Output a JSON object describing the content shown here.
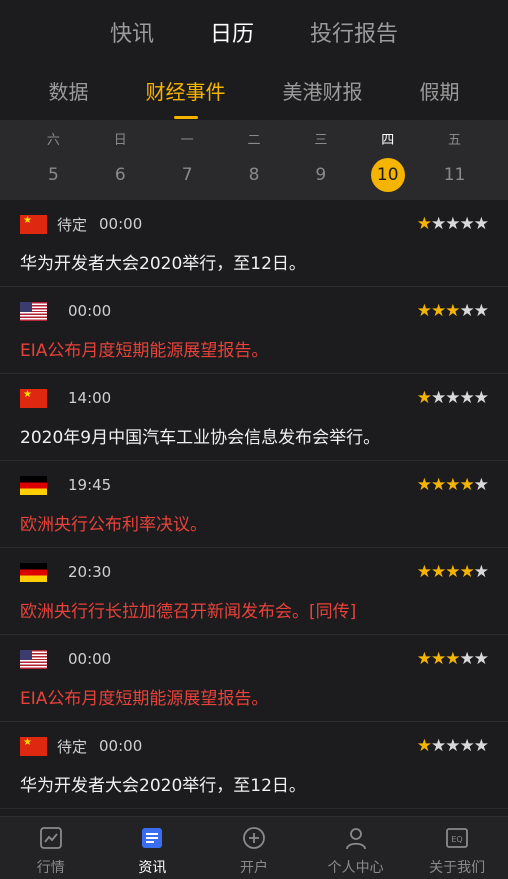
{
  "top_tabs": [
    {
      "label": "快讯",
      "active": false
    },
    {
      "label": "日历",
      "active": true
    },
    {
      "label": "投行报告",
      "active": false
    }
  ],
  "sub_tabs": [
    {
      "label": "数据",
      "active": false
    },
    {
      "label": "财经事件",
      "active": true
    },
    {
      "label": "美港财报",
      "active": false
    },
    {
      "label": "假期",
      "active": false
    }
  ],
  "week": [
    {
      "weekday": "六",
      "date": "5"
    },
    {
      "weekday": "日",
      "date": "6"
    },
    {
      "weekday": "一",
      "date": "7"
    },
    {
      "weekday": "二",
      "date": "8"
    },
    {
      "weekday": "三",
      "date": "9"
    },
    {
      "weekday": "四",
      "date": "10",
      "active": true
    },
    {
      "weekday": "五",
      "date": "11"
    }
  ],
  "events": [
    {
      "flag": "cn",
      "status": "待定",
      "time": "00:00",
      "stars": 1,
      "title": "华为开发者大会2020举行，至12日。",
      "highlight": false
    },
    {
      "flag": "us",
      "status": "",
      "time": "00:00",
      "stars": 3,
      "title": "EIA公布月度短期能源展望报告。",
      "highlight": true
    },
    {
      "flag": "cn",
      "status": "",
      "time": "14:00",
      "stars": 1,
      "title": "2020年9月中国汽车工业协会信息发布会举行。",
      "highlight": false
    },
    {
      "flag": "de",
      "status": "",
      "time": "19:45",
      "stars": 4,
      "title": "欧洲央行公布利率决议。",
      "highlight": true
    },
    {
      "flag": "de",
      "status": "",
      "time": "20:30",
      "stars": 4,
      "title": "欧洲央行行长拉加德召开新闻发布会。[同传]",
      "highlight": true
    },
    {
      "flag": "us",
      "status": "",
      "time": "00:00",
      "stars": 3,
      "title": "EIA公布月度短期能源展望报告。",
      "highlight": true
    },
    {
      "flag": "cn",
      "status": "待定",
      "time": "00:00",
      "stars": 1,
      "title": "华为开发者大会2020举行，至12日。",
      "highlight": false
    }
  ],
  "bottom_nav": [
    {
      "label": "行情",
      "icon": "chart-icon",
      "active": false
    },
    {
      "label": "资讯",
      "icon": "news-icon",
      "active": true
    },
    {
      "label": "开户",
      "icon": "plus-circle-icon",
      "active": false
    },
    {
      "label": "个人中心",
      "icon": "user-icon",
      "active": false
    },
    {
      "label": "关于我们",
      "icon": "about-icon",
      "active": false
    }
  ],
  "colors": {
    "accent": "#f5b400",
    "highlight_text": "#e8423a",
    "background": "#1c1c1e"
  }
}
